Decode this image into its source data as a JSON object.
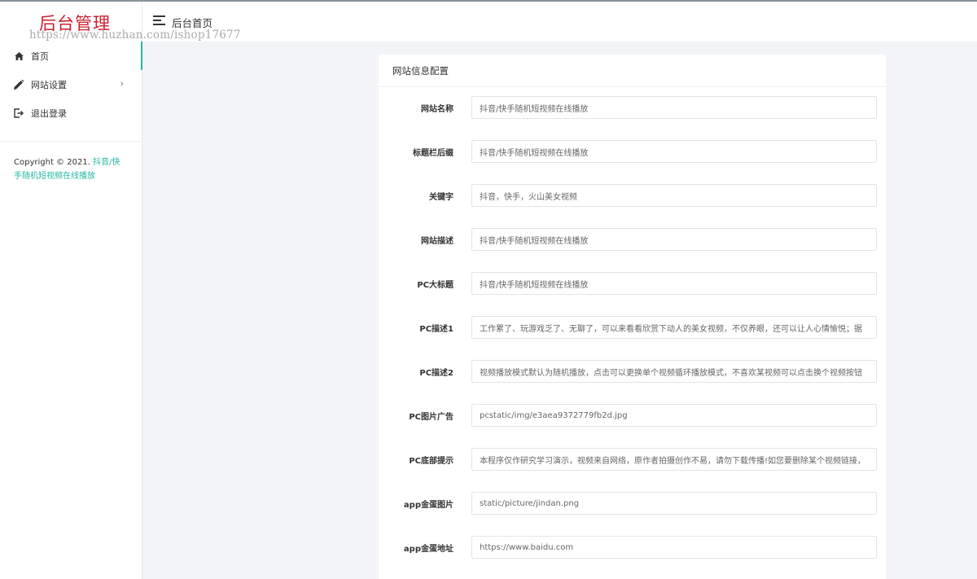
{
  "brand": {
    "title": "后台管理",
    "watermark": "https://www.huzhan.com/ishop17677"
  },
  "sidebar": {
    "items": [
      {
        "label": "首页",
        "icon": "home-icon",
        "active": true
      },
      {
        "label": "网站设置",
        "icon": "pencil-icon",
        "has_submenu": true
      },
      {
        "label": "退出登录",
        "icon": "logout-icon"
      }
    ],
    "copyright_prefix": "Copyright © 2021.",
    "copyright_link": "抖音/快手随机短视频在线播放"
  },
  "header": {
    "title": "后台首页"
  },
  "card": {
    "title": "网站信息配置",
    "fields": [
      {
        "label": "网站名称",
        "value": "抖音/快手随机短视频在线播放"
      },
      {
        "label": "标题栏后缀",
        "value": "抖音/快手随机短视频在线播放"
      },
      {
        "label": "关键字",
        "value": "抖音，快手，火山美女视频"
      },
      {
        "label": "网站描述",
        "value": "抖音/快手随机短视频在线播放"
      },
      {
        "label": "PC大标题",
        "value": "抖音/快手随机短视频在线播放"
      },
      {
        "label": "PC描述1",
        "value": "工作累了、玩游戏乏了、无聊了，可以来看看欣赏下动人的美女视频，不仅养眼，还可以让人心情愉悦；据"
      },
      {
        "label": "PC描述2",
        "value": "视频播放模式默认为随机播放，点击可以更换单个视频循环播放模式，不喜欢某视频可以点击换个视频按钮"
      },
      {
        "label": "PC图片广告",
        "value": "pcstatic/img/e3aea9372779fb2d.jpg"
      },
      {
        "label": "PC底部提示",
        "value": "本程序仅作研究学习演示，视频来自网络，原作者拍摄创作不易，请勿下载传播!如您要删除某个视频链接，"
      },
      {
        "label": "app金蛋图片",
        "value": "static/picture/jindan.png"
      },
      {
        "label": "app金蛋地址",
        "value": "https://www.baidu.com"
      }
    ]
  },
  "colors": {
    "accent": "#25b8a4",
    "brand": "#cc1f2f",
    "background": "#f3f4f7"
  }
}
